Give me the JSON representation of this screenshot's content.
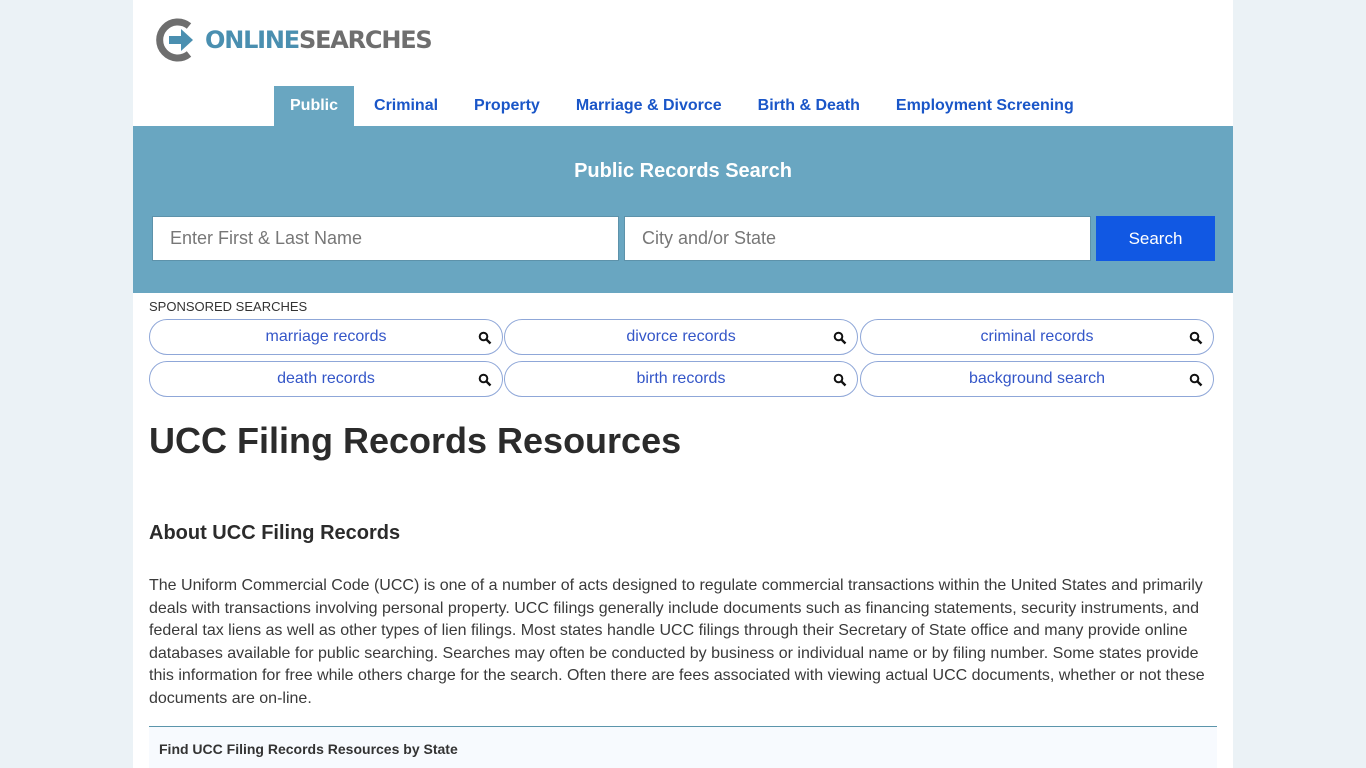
{
  "logo": {
    "part1": "ONLINE",
    "part2": "SEARCHES"
  },
  "nav": [
    {
      "label": "Public",
      "active": true
    },
    {
      "label": "Criminal"
    },
    {
      "label": "Property"
    },
    {
      "label": "Marriage & Divorce"
    },
    {
      "label": "Birth & Death"
    },
    {
      "label": "Employment Screening"
    }
  ],
  "hero": {
    "title": "Public Records Search",
    "name_placeholder": "Enter First & Last Name",
    "location_placeholder": "City and/or State",
    "search_label": "Search"
  },
  "sponsored": {
    "label": "SPONSORED SEARCHES",
    "items": [
      "marriage records",
      "divorce records",
      "criminal records",
      "death records",
      "birth records",
      "background search"
    ]
  },
  "main": {
    "title": "UCC Filing Records Resources",
    "subtitle": "About UCC Filing Records",
    "paragraph": "The Uniform Commercial Code (UCC) is one of a number of acts designed to regulate commercial transactions within the United States and primarily deals with transactions involving personal property. UCC filings generally include documents such as financing statements, security instruments, and federal tax liens as well as other types of lien filings. Most states handle UCC filings through their Secretary of State office and many provide online databases available for public searching. Searches may often be conducted by business or individual name or by filing number. Some states provide this information for free while others charge for the search. Often there are fees associated with viewing actual UCC documents, whether or not these documents are on-line.",
    "state_box_title": "Find UCC Filing Records Resources by State"
  }
}
